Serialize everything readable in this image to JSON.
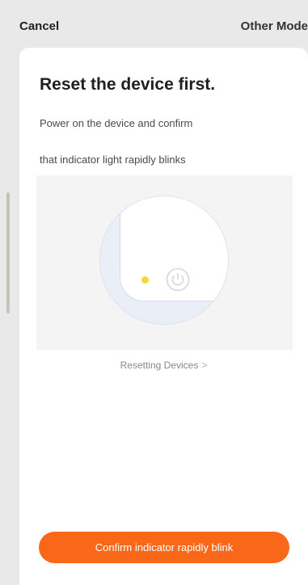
{
  "header": {
    "cancel_label": "Cancel",
    "other_mode_label": "Other Mode"
  },
  "card": {
    "title": "Reset the device first.",
    "description_line1": "Power on the device and confirm",
    "description_line2": "that indicator light rapidly blinks",
    "reset_link_label": "Resetting Devices",
    "reset_link_chevron": ">",
    "confirm_button_label": "Confirm indicator rapidly blink"
  },
  "icons": {
    "indicator": "indicator-light-icon",
    "power": "power-icon",
    "chevron": "chevron-right-icon"
  },
  "colors": {
    "accent": "#f86818",
    "indicator_light": "#f6d83a",
    "background": "#e9e9e9",
    "card": "#ffffff"
  }
}
